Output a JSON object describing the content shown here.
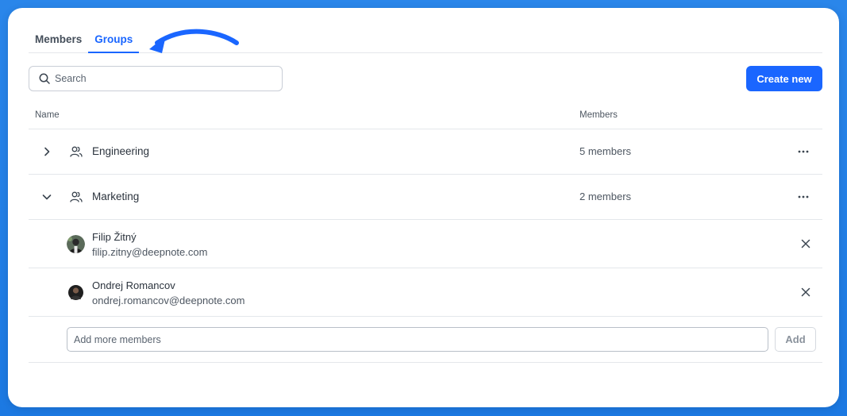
{
  "tabs": [
    {
      "label": "Members",
      "active": false
    },
    {
      "label": "Groups",
      "active": true
    }
  ],
  "search": {
    "placeholder": "Search",
    "icon": "search-icon"
  },
  "create_button": {
    "label": "Create new"
  },
  "table": {
    "columns": {
      "name": "Name",
      "members": "Members"
    },
    "groups": [
      {
        "name": "Engineering",
        "member_count": "5 members",
        "expanded": false
      },
      {
        "name": "Marketing",
        "member_count": "2 members",
        "expanded": true
      }
    ],
    "expanded_members": [
      {
        "name": "Filip Žitný",
        "email": "filip.zitny@deepnote.com"
      },
      {
        "name": "Ondrej Romancov",
        "email": "ondrej.romancov@deepnote.com"
      }
    ],
    "add_members": {
      "placeholder": "Add more members",
      "button_label": "Add"
    }
  },
  "colors": {
    "accent": "#1a66ff",
    "background": "#1e7ee6",
    "text_primary": "#2b333d",
    "text_secondary": "#4d5661",
    "border": "#e4e7eb"
  }
}
